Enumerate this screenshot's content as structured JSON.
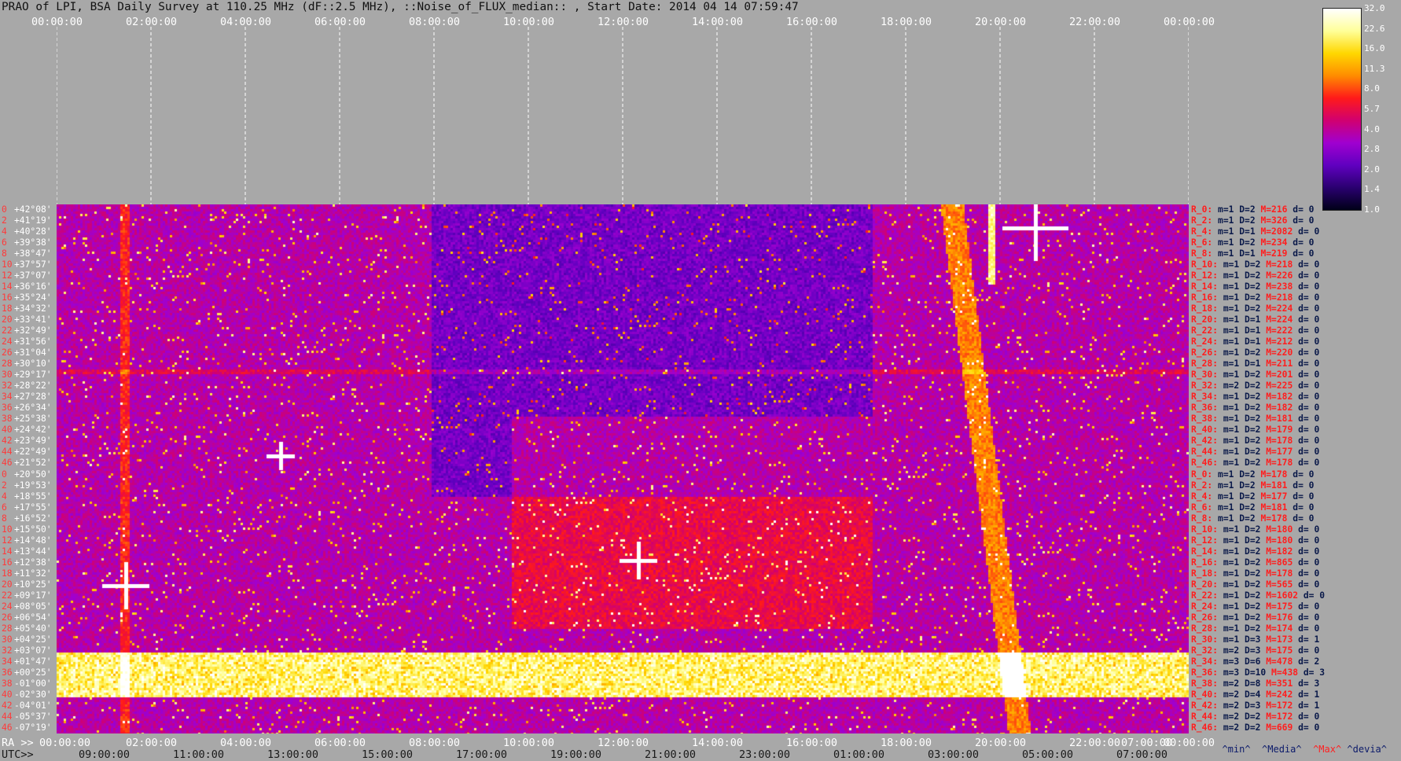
{
  "header": {
    "title": "PRAO of LPI, BSA Daily Survey at 110.25 MHz (dF::2.5 MHz), ::Noise_of_FLUX_median:: , Start Date: 2014 04 14 07:59:47",
    "top_time_ticks": [
      "00:00:00",
      "02:00:00",
      "04:00:00",
      "06:00:00",
      "08:00:00",
      "10:00:00",
      "12:00:00",
      "14:00:00",
      "16:00:00",
      "18:00:00",
      "20:00:00",
      "22:00:00",
      "00:00:00"
    ]
  },
  "colorbar": {
    "labels": [
      "32.0",
      "22.6",
      "16.0",
      "11.3",
      "8.0",
      "5.7",
      "4.0",
      "2.8",
      "2.0",
      "1.4",
      "1.0"
    ],
    "colors": [
      "#ffffff",
      "#ffff99",
      "#ffd700",
      "#ff8c00",
      "#ff1a1a",
      "#d10070",
      "#a000d0",
      "#6000c0",
      "#2a0070",
      "#000018"
    ]
  },
  "declinations": [
    "+42°08'",
    "+41°19'",
    "+40°28'",
    "+39°38'",
    "+38°47'",
    "+37°57'",
    "+37°07'",
    "+36°16'",
    "+35°24'",
    "+34°32'",
    "+33°41'",
    "+32°49'",
    "+31°56'",
    "+31°04'",
    "+30°10'",
    "+29°17'",
    "+28°22'",
    "+27°28'",
    "+26°34'",
    "+25°38'",
    "+24°42'",
    "+23°49'",
    "+22°49'",
    "+21°52'",
    "+20°50'",
    "+19°53'",
    "+18°55'",
    "+17°55'",
    "+16°52'",
    "+15°50'",
    "+14°48'",
    "+13°44'",
    "+12°38'",
    "+11°32'",
    "+10°25'",
    "+09°17'",
    "+08°05'",
    "+06°54'",
    "+05°40'",
    "+04°25'",
    "+03°07'",
    "+01°47'",
    "+00°25'",
    "-01°00'",
    "-02°30'",
    "-04°01'",
    "-05°37'",
    "-07°19'"
  ],
  "row_index_labels": [
    "0",
    "2",
    "4",
    "6",
    "8",
    "10",
    "12",
    "14",
    "16",
    "18",
    "20",
    "22",
    "24",
    "26",
    "28",
    "30",
    "32",
    "34",
    "36",
    "38",
    "40",
    "42",
    "44",
    "46",
    "0",
    "2",
    "4",
    "6",
    "8",
    "10",
    "12",
    "14",
    "16",
    "18",
    "20",
    "22",
    "24",
    "26",
    "28",
    "30",
    "32",
    "34",
    "36",
    "38",
    "40",
    "42",
    "44",
    "46"
  ],
  "row_stats": [
    {
      "r": "R_0:",
      "m": "m=1",
      "d": "D=2",
      "M": "M=216",
      "dv": "d= 0"
    },
    {
      "r": "R_2:",
      "m": "m=1",
      "d": "D=2",
      "M": "M=326",
      "dv": "d= 0"
    },
    {
      "r": "R_4:",
      "m": "m=1",
      "d": "D=1",
      "M": "M=2082",
      "dv": "d= 0"
    },
    {
      "r": "R_6:",
      "m": "m=1",
      "d": "D=2",
      "M": "M=234",
      "dv": "d= 0"
    },
    {
      "r": "R_8:",
      "m": "m=1",
      "d": "D=1",
      "M": "M=219",
      "dv": "d= 0"
    },
    {
      "r": "R_10:",
      "m": "m=1",
      "d": "D=2",
      "M": "M=218",
      "dv": "d= 0"
    },
    {
      "r": "R_12:",
      "m": "m=1",
      "d": "D=2",
      "M": "M=226",
      "dv": "d= 0"
    },
    {
      "r": "R_14:",
      "m": "m=1",
      "d": "D=2",
      "M": "M=238",
      "dv": "d= 0"
    },
    {
      "r": "R_16:",
      "m": "m=1",
      "d": "D=2",
      "M": "M=218",
      "dv": "d= 0"
    },
    {
      "r": "R_18:",
      "m": "m=1",
      "d": "D=2",
      "M": "M=224",
      "dv": "d= 0"
    },
    {
      "r": "R_20:",
      "m": "m=1",
      "d": "D=1",
      "M": "M=224",
      "dv": "d= 0"
    },
    {
      "r": "R_22:",
      "m": "m=1",
      "d": "D=1",
      "M": "M=222",
      "dv": "d= 0"
    },
    {
      "r": "R_24:",
      "m": "m=1",
      "d": "D=1",
      "M": "M=212",
      "dv": "d= 0"
    },
    {
      "r": "R_26:",
      "m": "m=1",
      "d": "D=2",
      "M": "M=220",
      "dv": "d= 0"
    },
    {
      "r": "R_28:",
      "m": "m=1",
      "d": "D=1",
      "M": "M=211",
      "dv": "d= 0"
    },
    {
      "r": "R_30:",
      "m": "m=1",
      "d": "D=2",
      "M": "M=201",
      "dv": "d= 0"
    },
    {
      "r": "R_32:",
      "m": "m=2",
      "d": "D=2",
      "M": "M=225",
      "dv": "d= 0"
    },
    {
      "r": "R_34:",
      "m": "m=1",
      "d": "D=2",
      "M": "M=182",
      "dv": "d= 0"
    },
    {
      "r": "R_36:",
      "m": "m=1",
      "d": "D=2",
      "M": "M=182",
      "dv": "d= 0"
    },
    {
      "r": "R_38:",
      "m": "m=1",
      "d": "D=2",
      "M": "M=181",
      "dv": "d= 0"
    },
    {
      "r": "R_40:",
      "m": "m=1",
      "d": "D=2",
      "M": "M=179",
      "dv": "d= 0"
    },
    {
      "r": "R_42:",
      "m": "m=1",
      "d": "D=2",
      "M": "M=178",
      "dv": "d= 0"
    },
    {
      "r": "R_44:",
      "m": "m=1",
      "d": "D=2",
      "M": "M=177",
      "dv": "d= 0"
    },
    {
      "r": "R_46:",
      "m": "m=1",
      "d": "D=2",
      "M": "M=178",
      "dv": "d= 0"
    },
    {
      "r": "R_0:",
      "m": "m=1",
      "d": "D=2",
      "M": "M=178",
      "dv": "d= 0"
    },
    {
      "r": "R_2:",
      "m": "m=1",
      "d": "D=2",
      "M": "M=181",
      "dv": "d= 0"
    },
    {
      "r": "R_4:",
      "m": "m=1",
      "d": "D=2",
      "M": "M=177",
      "dv": "d= 0"
    },
    {
      "r": "R_6:",
      "m": "m=1",
      "d": "D=2",
      "M": "M=181",
      "dv": "d= 0"
    },
    {
      "r": "R_8:",
      "m": "m=1",
      "d": "D=2",
      "M": "M=178",
      "dv": "d= 0"
    },
    {
      "r": "R_10:",
      "m": "m=1",
      "d": "D=2",
      "M": "M=180",
      "dv": "d= 0"
    },
    {
      "r": "R_12:",
      "m": "m=1",
      "d": "D=2",
      "M": "M=180",
      "dv": "d= 0"
    },
    {
      "r": "R_14:",
      "m": "m=1",
      "d": "D=2",
      "M": "M=182",
      "dv": "d= 0"
    },
    {
      "r": "R_16:",
      "m": "m=1",
      "d": "D=2",
      "M": "M=865",
      "dv": "d= 0"
    },
    {
      "r": "R_18:",
      "m": "m=1",
      "d": "D=2",
      "M": "M=178",
      "dv": "d= 0"
    },
    {
      "r": "R_20:",
      "m": "m=1",
      "d": "D=2",
      "M": "M=565",
      "dv": "d= 0"
    },
    {
      "r": "R_22:",
      "m": "m=1",
      "d": "D=2",
      "M": "M=1602",
      "dv": "d= 0"
    },
    {
      "r": "R_24:",
      "m": "m=1",
      "d": "D=2",
      "M": "M=175",
      "dv": "d= 0"
    },
    {
      "r": "R_26:",
      "m": "m=1",
      "d": "D=2",
      "M": "M=176",
      "dv": "d= 0"
    },
    {
      "r": "R_28:",
      "m": "m=1",
      "d": "D=2",
      "M": "M=174",
      "dv": "d= 0"
    },
    {
      "r": "R_30:",
      "m": "m=1",
      "d": "D=3",
      "M": "M=173",
      "dv": "d= 1"
    },
    {
      "r": "R_32:",
      "m": "m=2",
      "d": "D=3",
      "M": "M=175",
      "dv": "d= 0"
    },
    {
      "r": "R_34:",
      "m": "m=3",
      "d": "D=6",
      "M": "M=478",
      "dv": "d= 2"
    },
    {
      "r": "R_36:",
      "m": "m=3",
      "d": "D=10",
      "M": "M=438",
      "dv": "d= 3"
    },
    {
      "r": "R_38:",
      "m": "m=2",
      "d": "D=8",
      "M": "M=351",
      "dv": "d= 3"
    },
    {
      "r": "R_40:",
      "m": "m=2",
      "d": "D=4",
      "M": "M=242",
      "dv": "d= 1"
    },
    {
      "r": "R_42:",
      "m": "m=2",
      "d": "D=3",
      "M": "M=172",
      "dv": "d= 1"
    },
    {
      "r": "R_44:",
      "m": "m=2",
      "d": "D=2",
      "M": "M=172",
      "dv": "d= 0"
    },
    {
      "r": "R_46:",
      "m": "m=2",
      "d": "D=2",
      "M": "M=669",
      "dv": "d= 0"
    }
  ],
  "bottom": {
    "ra_prefix": "RA >>",
    "utc_prefix": "UTC>>",
    "ra_ticks": [
      "00:00:00",
      "02:00:00",
      "04:00:00",
      "06:00:00",
      "08:00:00",
      "10:00:00",
      "12:00:00",
      "14:00:00",
      "16:00:00",
      "18:00:00",
      "20:00:00",
      "22:00:00",
      "07:00:00",
      "00:00:00"
    ],
    "utc_ticks": [
      "09:00:00",
      "11:00:00",
      "13:00:00",
      "15:00:00",
      "17:00:00",
      "19:00:00",
      "21:00:00",
      "23:00:00",
      "01:00:00",
      "03:00:00",
      "05:00:00",
      "07:00:00"
    ],
    "legend": [
      "^min^",
      "^Media^",
      "^Max^",
      "^devia^"
    ]
  }
}
